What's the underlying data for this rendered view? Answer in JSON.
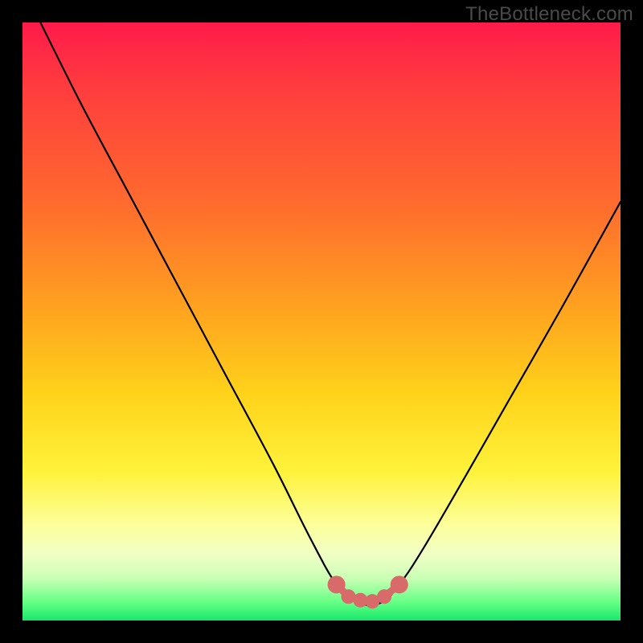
{
  "watermark": "TheBottleneck.com",
  "colors": {
    "frame": "#000000",
    "curve": "#000000",
    "marker": "#d96a6a",
    "gradient_stops": [
      "#ff1a4b",
      "#ff3a3f",
      "#ff6a2e",
      "#ffa31f",
      "#ffd21a",
      "#fff23a",
      "#fcff9a",
      "#f1ffc6",
      "#c9ffb4",
      "#64ff85",
      "#17e86a"
    ]
  },
  "chart_data": {
    "type": "line",
    "title": "",
    "xlabel": "",
    "ylabel": "",
    "xlim": [
      0,
      100
    ],
    "ylim": [
      0,
      100
    ],
    "grid": false,
    "legend": false,
    "series": [
      {
        "name": "bottleneck-curve",
        "x": [
          3,
          10,
          18,
          26,
          34,
          42,
          48,
          52.5,
          56,
          60,
          63,
          67,
          74,
          82,
          90,
          100
        ],
        "y": [
          100,
          86,
          71,
          56,
          41,
          26,
          14,
          6,
          3,
          3,
          6,
          12,
          24,
          38,
          52,
          70
        ]
      }
    ],
    "markers": [
      {
        "x": 52.5,
        "y": 6,
        "r": 1.2
      },
      {
        "x": 54.5,
        "y": 4,
        "r": 0.9
      },
      {
        "x": 56.5,
        "y": 3.4,
        "r": 0.9
      },
      {
        "x": 58.5,
        "y": 3.2,
        "r": 0.9
      },
      {
        "x": 60.5,
        "y": 4,
        "r": 0.9
      },
      {
        "x": 63,
        "y": 6,
        "r": 1.2
      }
    ]
  }
}
